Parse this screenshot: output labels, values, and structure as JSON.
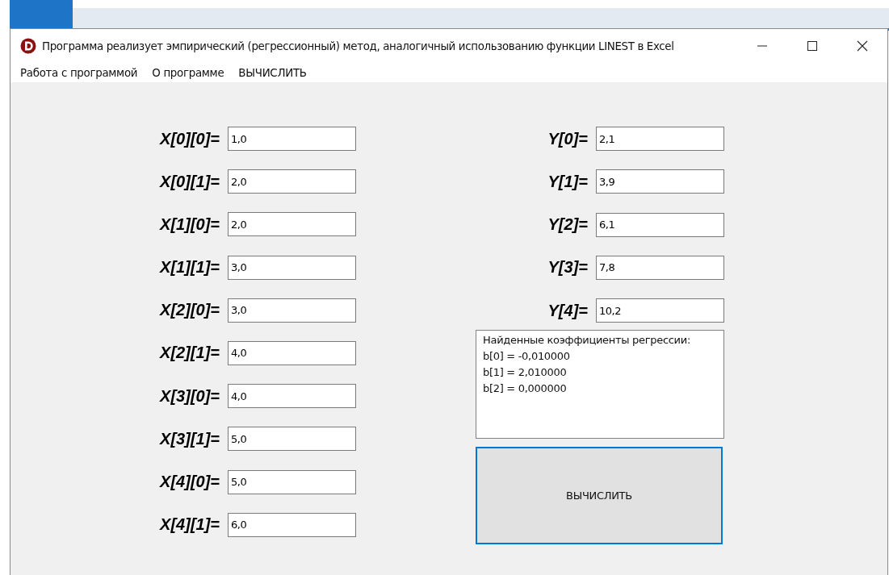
{
  "window": {
    "title": "Программа реализует эмпирический (регрессионный) метод, аналогичный использованию функции LINEST в Excel"
  },
  "menu": [
    "Работа с программой",
    "О программе",
    "ВЫЧИСЛИТЬ"
  ],
  "x_fields": [
    {
      "label": "X[0][0]=",
      "value": "1,0"
    },
    {
      "label": "X[0][1]=",
      "value": "2,0"
    },
    {
      "label": "X[1][0]=",
      "value": "2,0"
    },
    {
      "label": "X[1][1]=",
      "value": "3,0"
    },
    {
      "label": "X[2][0]=",
      "value": "3,0"
    },
    {
      "label": "X[2][1]=",
      "value": "4,0"
    },
    {
      "label": "X[3][0]=",
      "value": "4,0"
    },
    {
      "label": "X[3][1]=",
      "value": "5,0"
    },
    {
      "label": "X[4][0]=",
      "value": "5,0"
    },
    {
      "label": "X[4][1]=",
      "value": "6,0"
    }
  ],
  "y_fields": [
    {
      "label": "Y[0]=",
      "value": "2,1"
    },
    {
      "label": "Y[1]=",
      "value": "3,9"
    },
    {
      "label": "Y[2]=",
      "value": "6,1"
    },
    {
      "label": "Y[3]=",
      "value": "7,8"
    },
    {
      "label": "Y[4]=",
      "value": "10,2"
    }
  ],
  "result_lines": [
    "Найденные коэффициенты регрессии:",
    "b[0] = -0,010000",
    "b[1] = 2,010000",
    "b[2] = 0,000000"
  ],
  "compute_button": {
    "label": "ВЫЧИСЛИТЬ",
    "focused": true
  }
}
